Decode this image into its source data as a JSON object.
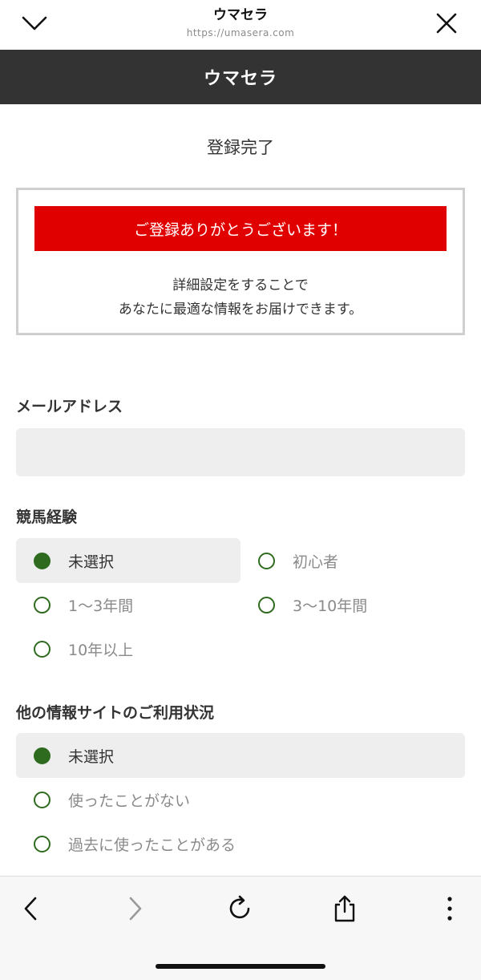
{
  "browser": {
    "title": "ウマセラ",
    "url": "https://umasera.com"
  },
  "header": {
    "site_name": "ウマセラ"
  },
  "page": {
    "title": "登録完了"
  },
  "message": {
    "banner": "ご登録ありがとうございます！",
    "line1": "詳細設定をすることで",
    "line2": "あなたに最適な情報をお届けできます。"
  },
  "email": {
    "label": "メールアドレス",
    "value": ""
  },
  "experience": {
    "label": "競馬経験",
    "options": [
      "未選択",
      "初心者",
      "1〜3年間",
      "3〜10年間",
      "10年以上"
    ],
    "selected": "未選択"
  },
  "other_sites": {
    "label": "他の情報サイトのご利用状況",
    "options": [
      "未選択",
      "使ったことがない",
      "過去に使ったことがある"
    ],
    "selected": "未選択"
  },
  "colors": {
    "header_bg": "#333333",
    "banner_red": "#e10000",
    "radio_green": "#2e6b1f",
    "selected_bg": "#eeeeee"
  }
}
